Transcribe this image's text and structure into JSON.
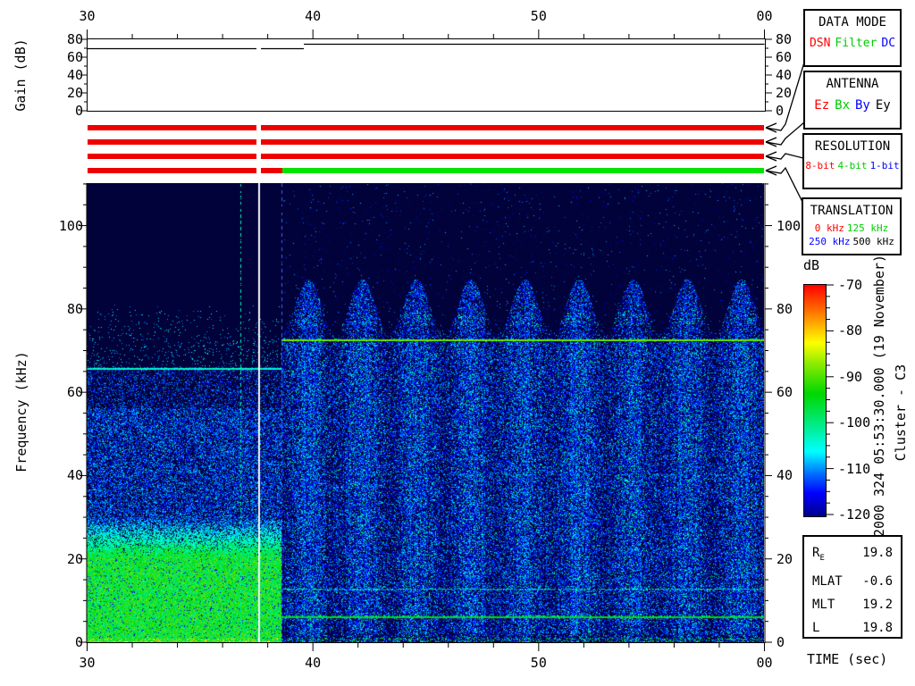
{
  "labels": {
    "gain_axis": "Gain (dB)",
    "freq_axis": "Frequency (kHz)",
    "time_axis": "TIME (sec)",
    "colorbar_unit": "dB",
    "datetime": "2000 324 05:53:30.000 (19 November)",
    "spacecraft": "Cluster - C3"
  },
  "side_panels": {
    "data_mode": {
      "title": "DATA MODE",
      "items": [
        {
          "label": "DSN",
          "color": "#ff0000"
        },
        {
          "label": "Filter",
          "color": "#00cc00"
        },
        {
          "label": "DC",
          "color": "#0000ff"
        }
      ]
    },
    "antenna": {
      "title": "ANTENNA",
      "items": [
        {
          "label": "Ez",
          "color": "#ff0000"
        },
        {
          "label": "Bx",
          "color": "#00cc00"
        },
        {
          "label": "By",
          "color": "#0000ff"
        },
        {
          "label": "Ey",
          "color": "#000000"
        }
      ]
    },
    "resolution": {
      "title": "RESOLUTION",
      "items": [
        {
          "label": "8-bit",
          "color": "#ff0000"
        },
        {
          "label": "4-bit",
          "color": "#00cc00"
        },
        {
          "label": "1-bit",
          "color": "#0000ff"
        }
      ]
    },
    "translation": {
      "title": "TRANSLATION",
      "rows": [
        [
          {
            "label": "0 kHz",
            "color": "#ff0000"
          },
          {
            "label": "125 kHz",
            "color": "#00cc00"
          }
        ],
        [
          {
            "label": "250 kHz",
            "color": "#0000ff"
          },
          {
            "label": "500 kHz",
            "color": "#000000"
          }
        ]
      ]
    }
  },
  "ephemeris": {
    "rows": [
      {
        "label": "R",
        "sub": "E",
        "value": "19.8"
      },
      {
        "label": "MLAT",
        "sub": "",
        "value": "-0.6"
      },
      {
        "label": "MLT",
        "sub": "",
        "value": "19.2"
      },
      {
        "label": "L",
        "sub": "",
        "value": "19.8"
      }
    ]
  },
  "chart_data": {
    "time_axis": {
      "range_sec": [
        30,
        60
      ],
      "major_ticks": [
        {
          "t": 30,
          "label": "30"
        },
        {
          "t": 40,
          "label": "40"
        },
        {
          "t": 50,
          "label": "50"
        },
        {
          "t": 60,
          "label": "00"
        }
      ],
      "minor_step_sec": 2
    },
    "gain_plot": {
      "type": "line",
      "ylabel": "Gain (dB)",
      "ylim": [
        0,
        80
      ],
      "yticks": [
        {
          "v": 0,
          "label": "0"
        },
        {
          "v": 20,
          "label": "20"
        },
        {
          "v": 40,
          "label": "40"
        },
        {
          "v": 60,
          "label": "60"
        },
        {
          "v": 80,
          "label": "80"
        }
      ],
      "yticks_minor": [
        10,
        30,
        50,
        70
      ],
      "segments": [
        {
          "t0": 30.0,
          "t1": 37.5,
          "gain_db": 70
        },
        {
          "t0": 37.7,
          "t1": 39.6,
          "gain_db": 70
        },
        {
          "t0": 39.6,
          "t1": 60.0,
          "gain_db": 75
        }
      ]
    },
    "mode_bars": {
      "type": "status-bars",
      "rows": [
        {
          "name": "data-mode-bar",
          "segments": [
            {
              "t0": 30.0,
              "t1": 37.5,
              "color": "#ee0000"
            },
            {
              "t0": 37.7,
              "t1": 60.0,
              "color": "#ee0000"
            }
          ]
        },
        {
          "name": "antenna-bar",
          "segments": [
            {
              "t0": 30.0,
              "t1": 37.5,
              "color": "#ee0000"
            },
            {
              "t0": 37.7,
              "t1": 60.0,
              "color": "#ee0000"
            }
          ]
        },
        {
          "name": "resolution-bar",
          "segments": [
            {
              "t0": 30.0,
              "t1": 37.5,
              "color": "#ee0000"
            },
            {
              "t0": 37.7,
              "t1": 60.0,
              "color": "#ee0000"
            }
          ]
        },
        {
          "name": "translation-bar",
          "segments": [
            {
              "t0": 30.0,
              "t1": 37.5,
              "color": "#ee0000"
            },
            {
              "t0": 37.7,
              "t1": 38.63,
              "color": "#ee0000"
            },
            {
              "t0": 38.63,
              "t1": 60.0,
              "color": "#00e400"
            }
          ]
        }
      ]
    },
    "spectrogram": {
      "type": "heatmap",
      "ylabel": "Frequency (kHz)",
      "xlabel": "TIME (sec)",
      "freq_range_khz": [
        0,
        110
      ],
      "yticks": [
        {
          "v": 0,
          "label": "0"
        },
        {
          "v": 20,
          "label": "20"
        },
        {
          "v": 40,
          "label": "40"
        },
        {
          "v": 60,
          "label": "60"
        },
        {
          "v": 80,
          "label": "80"
        },
        {
          "v": 100,
          "label": "100"
        }
      ],
      "ytick_minor_step_khz": 5,
      "level_range_db": [
        -120,
        -70
      ],
      "mode_transition_sec": 38.63,
      "left_region": {
        "description": "broadband noise, strongest (green, ~-92 dB) below 20 kHz, fading to blue by 30 kHz, sparse above 66 kHz",
        "dense_below_khz": 20,
        "fade_to_khz": 30,
        "sparse_above_khz": 66
      },
      "right_region": {
        "description": "periodic vertical emission bands (arcs) to ~87 kHz over dense blue noise below 72 kHz",
        "band_period_sec": 2.4,
        "first_band_center_sec": 39.8,
        "band_top_khz": 87,
        "gap_top_khz": 74
      },
      "h_lines": [
        {
          "freq_khz": 65.5,
          "t0": 30.0,
          "t1": 38.63,
          "level_db": -105,
          "style": "solid"
        },
        {
          "freq_khz": 72.4,
          "t0": 38.63,
          "t1": 60.0,
          "level_db": -90,
          "style": "solid"
        },
        {
          "freq_khz": 6.0,
          "t0": 38.63,
          "t1": 60.0,
          "level_db": -96,
          "style": "solid"
        },
        {
          "freq_khz": 12.7,
          "t0": 38.63,
          "t1": 60.0,
          "level_db": -104,
          "style": "speckled"
        },
        {
          "freq_khz": 40.0,
          "t0": 38.63,
          "t1": 60.0,
          "level_db": -109,
          "style": "faint"
        }
      ],
      "v_lines": [
        {
          "t": 36.8,
          "style": "dotted",
          "color": "cyan"
        },
        {
          "t": 37.6,
          "style": "solid",
          "color": "#ffffff"
        },
        {
          "t": 38.63,
          "style": "dashed",
          "color": "#3c64ff"
        }
      ]
    },
    "colorbar": {
      "label": "dB",
      "range_db": [
        -120,
        -70
      ],
      "ticks": [
        {
          "v": -70,
          "label": "-70"
        },
        {
          "v": -80,
          "label": "-80"
        },
        {
          "v": -90,
          "label": "-90"
        },
        {
          "v": -100,
          "label": "-100"
        },
        {
          "v": -110,
          "label": "-110"
        },
        {
          "v": -120,
          "label": "-120"
        }
      ],
      "minor_step_db": 2.5,
      "stops": [
        [
          0.0,
          [
            0,
            0,
            140
          ]
        ],
        [
          0.1,
          [
            0,
            0,
            255
          ]
        ],
        [
          0.19,
          [
            0,
            120,
            255
          ]
        ],
        [
          0.28,
          [
            0,
            255,
            255
          ]
        ],
        [
          0.4,
          [
            0,
            235,
            130
          ]
        ],
        [
          0.53,
          [
            0,
            215,
            0
          ]
        ],
        [
          0.66,
          [
            140,
            235,
            0
          ]
        ],
        [
          0.75,
          [
            255,
            255,
            0
          ]
        ],
        [
          0.87,
          [
            255,
            130,
            0
          ]
        ],
        [
          1.0,
          [
            255,
            0,
            0
          ]
        ]
      ]
    }
  }
}
